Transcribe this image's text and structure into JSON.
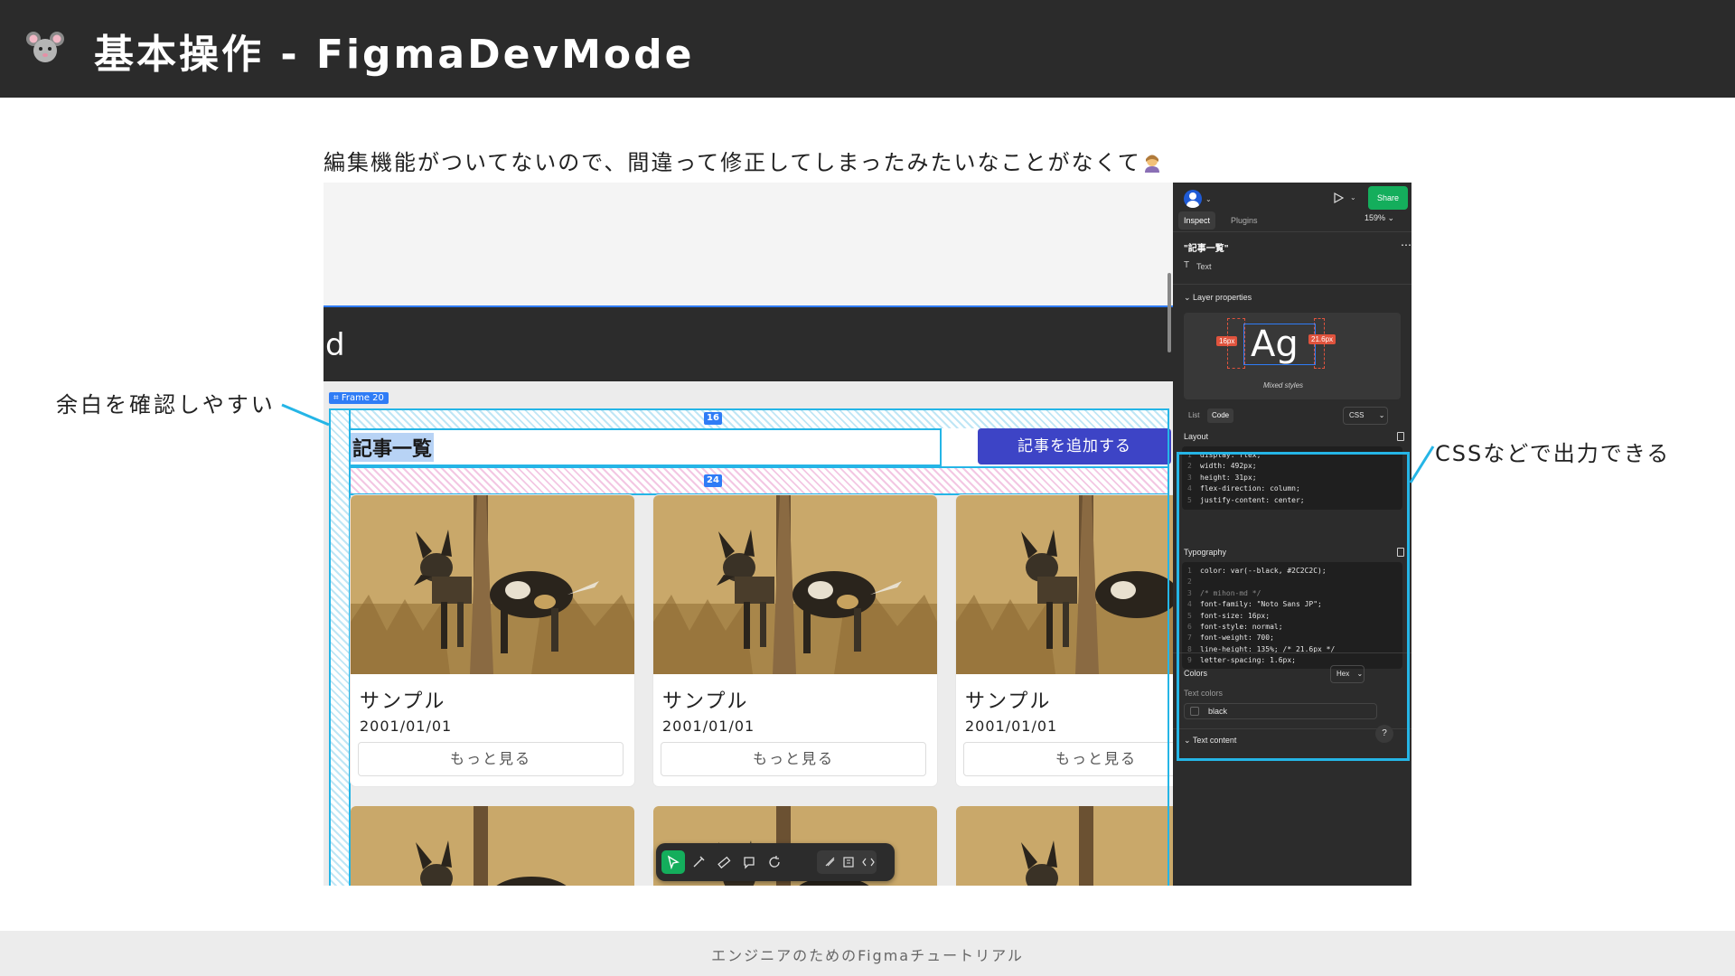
{
  "header": {
    "title": "基本操作 - FigmaDevMode",
    "logo_icon": "mouse-face-icon"
  },
  "subtitle": {
    "text": "編集機能がついてないので、間違って修正してしまったみたいなことがなくて",
    "emoji_icon": "person-gesturing-ok-icon"
  },
  "annotations": {
    "left": "余白を確認しやすい",
    "right": "CSSなどで出力できる"
  },
  "footer": {
    "text": "エンジニアのためのFigmaチュートリアル"
  },
  "canvas": {
    "dark_band_text": "d",
    "frame_label": "Frame 20",
    "spacing_top": "16",
    "spacing_between": "24",
    "list_title": "記事一覧",
    "add_button": "記事を追加する",
    "cards": [
      {
        "name": "サンプル",
        "date": "2001/01/01",
        "more": "もっと見る"
      },
      {
        "name": "サンプル",
        "date": "2001/01/01",
        "more": "もっと見る"
      },
      {
        "name": "サンプル",
        "date": "2001/01/01",
        "more": "もっと見る"
      }
    ],
    "toolbar_icons": [
      "move-icon",
      "pen-icon",
      "ruler-icon",
      "comment-icon",
      "rotate-icon",
      "measure-icon",
      "annotate-icon",
      "code-icon"
    ]
  },
  "panel": {
    "share": "Share",
    "tabs": {
      "inspect": "Inspect",
      "plugins": "Plugins"
    },
    "zoom": "159%",
    "layer_name": "\"記事一覧\"",
    "layer_type": "Text",
    "layer_properties": "Layer properties",
    "ag": "Ag",
    "left_spacing": "16px",
    "line_height_badge": "21.6px",
    "mixed_styles": "Mixed styles",
    "code_tabs": {
      "list": "List",
      "code": "Code"
    },
    "css_select": "CSS",
    "layout_label": "Layout",
    "layout_code": [
      "display: flex;",
      "width: 492px;",
      "height: 31px;",
      "flex-direction: column;",
      "justify-content: center;"
    ],
    "typography_label": "Typography",
    "typography_code": [
      "color: var(--black, #2C2C2C);",
      "",
      "/* mihon-md */",
      "font-family: \"Noto Sans JP\";",
      "font-size: 16px;",
      "font-style: normal;",
      "font-weight: 700;",
      "line-height: 135%; /* 21.6px */",
      "letter-spacing: 1.6px;"
    ],
    "colors_label": "Colors",
    "hex_select": "Hex",
    "text_colors_label": "Text colors",
    "color_name": "black",
    "text_content_label": "Text content",
    "help": "?"
  },
  "colors": {
    "header_bg": "#2b2b2b",
    "accent_cyan": "#25b5e6",
    "button_indigo": "#3d44c6",
    "share_green": "#14ae5c",
    "panel_bg": "#2c2c2c"
  }
}
